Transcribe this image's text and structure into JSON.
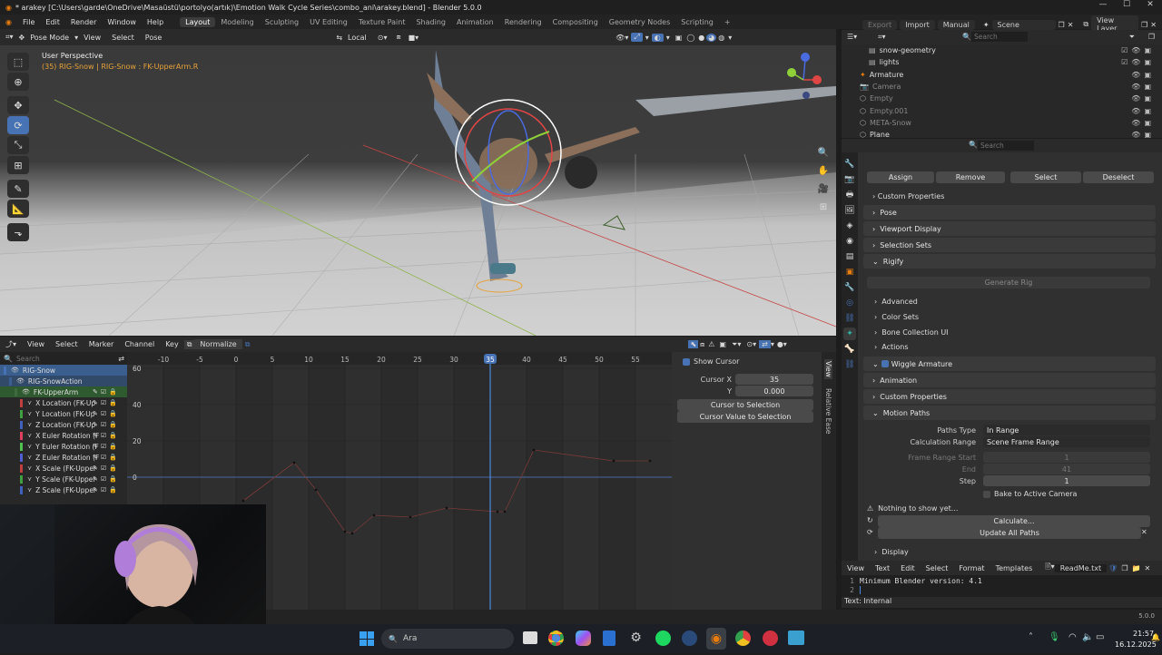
{
  "title_bar": {
    "title": "* arakey [C:\\Users\\garde\\OneDrive\\Masaüstü\\portolyo(artık)\\Emotion Walk Cycle Series\\combo_ani\\arakey.blend] - Blender 5.0.0"
  },
  "menu": {
    "items": [
      "File",
      "Edit",
      "Render",
      "Window",
      "Help"
    ],
    "workspaces": [
      "Layout",
      "Modeling",
      "Sculpting",
      "UV Editing",
      "Texture Paint",
      "Shading",
      "Animation",
      "Rendering",
      "Compositing",
      "Geometry Nodes",
      "Scripting"
    ],
    "active_workspace": "Layout",
    "add_tab": "+",
    "export_label": "Export",
    "import_label": "Import",
    "manual_label": "Manual",
    "scene_label": "Scene",
    "viewlayer_label": "View Layer"
  },
  "viewport": {
    "mode": "Pose Mode",
    "menus": [
      "View",
      "Select",
      "Pose"
    ],
    "transform_orientation": "Local",
    "perspective": "User Perspective",
    "active_info": "(35) RIG-Snow | RIG-Snow : FK-UpperArm.R"
  },
  "graph_editor": {
    "menus": [
      "View",
      "Select",
      "Marker",
      "Channel",
      "Key"
    ],
    "normalize_label": "Normalize",
    "search_placeholder": "Search",
    "frame_ticks": [
      "-10",
      "-5",
      "0",
      "5",
      "10",
      "15",
      "20",
      "25",
      "30",
      "35",
      "40",
      "45",
      "50",
      "55"
    ],
    "current_frame": "35",
    "y_ticks": [
      "60",
      "40",
      "20",
      "0"
    ],
    "channels": [
      {
        "label": "RIG-Snow",
        "color": "#4772b3",
        "indent": 0
      },
      {
        "label": "RIG-SnowAction",
        "color": "#3a5f8f",
        "indent": 1
      },
      {
        "label": "FK-UpperArm",
        "color": "#3d6b3d",
        "indent": 2
      },
      {
        "label": "X Location (FK-Up",
        "color": "#c04040",
        "indent": 3
      },
      {
        "label": "Y Location (FK-Up",
        "color": "#40a040",
        "indent": 3
      },
      {
        "label": "Z Location (FK-Up",
        "color": "#4060c0",
        "indent": 3
      },
      {
        "label": "X Euler Rotation (F",
        "color": "#e04060",
        "indent": 3
      },
      {
        "label": "Y Euler Rotation (F",
        "color": "#50c050",
        "indent": 3
      },
      {
        "label": "Z Euler Rotation (F",
        "color": "#5060d0",
        "indent": 3
      },
      {
        "label": "X Scale (FK-Upper",
        "color": "#c04040",
        "indent": 3
      },
      {
        "label": "Y Scale (FK-Upper",
        "color": "#40a040",
        "indent": 3
      },
      {
        "label": "Z Scale (FK-Upper",
        "color": "#4060c0",
        "indent": 3
      }
    ],
    "sidebar": {
      "show_cursor": "Show Cursor",
      "cursor_x_label": "Cursor X",
      "cursor_x": "35",
      "y_label": "Y",
      "y_value": "0.000",
      "cursor_to_selection": "Cursor to Selection",
      "cursor_value_to_selection": "Cursor Value to Selection"
    },
    "side_tabs": [
      "View",
      "Relative Ease"
    ]
  },
  "outliner": {
    "search_placeholder": "Search",
    "items": [
      {
        "label": "snow-geometry",
        "dim": false
      },
      {
        "label": "lights",
        "dim": false
      },
      {
        "label": "Armature",
        "dim": false
      },
      {
        "label": "Camera",
        "dim": true
      },
      {
        "label": "Empty",
        "dim": true
      },
      {
        "label": "Empty.001",
        "dim": true
      },
      {
        "label": "META-Snow",
        "dim": true
      },
      {
        "label": "Plane",
        "dim": false
      }
    ]
  },
  "properties": {
    "search_placeholder": "Search",
    "buttons_row": [
      "Assign",
      "Remove",
      "Select",
      "Deselect"
    ],
    "custom_properties_sub": "Custom Properties",
    "panels": [
      "Pose",
      "Viewport Display",
      "Selection Sets",
      "Rigify"
    ],
    "generate_rig": "Generate Rig",
    "rigify_subs": [
      "Advanced",
      "Color Sets",
      "Bone Collection UI",
      "Actions"
    ],
    "wiggle_armature": "Wiggle Armature",
    "animation": "Animation",
    "custom_properties": "Custom Properties",
    "motion_paths": "Motion Paths",
    "paths_type_label": "Paths Type",
    "paths_type_value": "In Range",
    "calc_range_label": "Calculation Range",
    "calc_range_value": "Scene Frame Range",
    "frame_range_start_label": "Frame Range Start",
    "frame_range_start": "1",
    "end_label": "End",
    "end_value": "41",
    "step_label": "Step",
    "step_value": "1",
    "bake_to_camera": "Bake to Active Camera",
    "nothing_to_show": "Nothing to show yet...",
    "calculate": "Calculate...",
    "update_all_paths": "Update All Paths",
    "display": "Display"
  },
  "text_editor": {
    "menus": [
      "View",
      "Text",
      "Edit",
      "Select",
      "Format",
      "Templates"
    ],
    "file_name": "ReadMe.txt",
    "lines": [
      {
        "num": "1",
        "text": "Minimum Blender version: 4.1"
      },
      {
        "num": "2",
        "text": ""
      }
    ],
    "footer": "Text: Internal"
  },
  "status_bar": {
    "version": "5.0.0"
  },
  "taskbar": {
    "search_placeholder": "Ara",
    "time": "21:57",
    "date": "16.12.2025"
  },
  "colors": {
    "accent": "#4772b3",
    "orange": "#e6a23a"
  }
}
